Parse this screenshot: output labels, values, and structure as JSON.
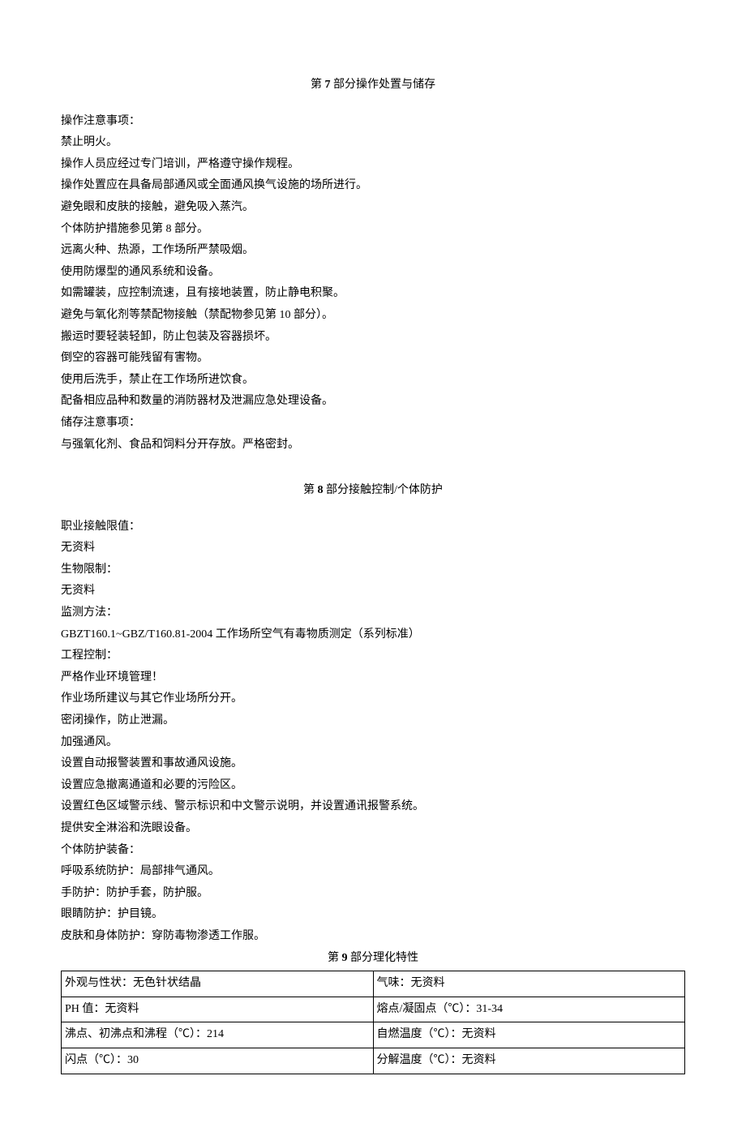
{
  "section7": {
    "heading_pre": "第 ",
    "heading_num": "7",
    "heading_post": " 部分操作处置与储存",
    "lines": [
      "操作注意事项：",
      "禁止明火。",
      "操作人员应经过专门培训，严格遵守操作规程。",
      "操作处置应在具备局部通风或全面通风换气设施的场所进行。",
      "避免眼和皮肤的接触，避免吸入蒸汽。",
      "个体防护措施参见第 8 部分。",
      "远离火种、热源，工作场所严禁吸烟。",
      "使用防爆型的通风系统和设备。",
      "如需罐装，应控制流速，且有接地装置，防止静电积聚。",
      "避免与氧化剂等禁配物接触（禁配物参见第 10 部分）。",
      "搬运时要轻装轻卸，防止包装及容器损坏。",
      "倒空的容器可能残留有害物。",
      "使用后洗手，禁止在工作场所进饮食。",
      "配备相应品种和数量的消防器材及泄漏应急处理设备。",
      "储存注意事项：",
      "与强氧化剂、食品和饲料分开存放。严格密封。"
    ]
  },
  "section8": {
    "heading_pre": "第 ",
    "heading_num": "8",
    "heading_post": " 部分接触控制/个体防护",
    "lines": [
      "职业接触限值：",
      "无资料",
      "生物限制：",
      "无资料",
      "监测方法：",
      "GBZT160.1~GBZ/T160.81-2004 工作场所空气有毒物质测定（系列标准）",
      "工程控制：",
      "严格作业环境管理！",
      "作业场所建议与其它作业场所分开。",
      "密闭操作，防止泄漏。",
      "加强通风。",
      "设置自动报警装置和事故通风设施。",
      "设置应急撤离通道和必要的污险区。",
      "设置红色区域警示线、警示标识和中文警示说明，并设置通讯报警系统。",
      "提供安全淋浴和洗眼设备。",
      "个体防护装备：",
      "呼吸系统防护：局部排气通风。",
      "手防护：防护手套，防护服。",
      "眼睛防护：护目镜。",
      "皮肤和身体防护：穿防毒物渗透工作服。"
    ]
  },
  "section9": {
    "heading_pre": "第 ",
    "heading_num": "9",
    "heading_post": " 部分理化特性",
    "table": [
      {
        "left": "外观与性状：无色针状结晶",
        "right": "气味：无资料"
      },
      {
        "left": "PH 值：无资料",
        "right": "熔点/凝固点（℃）：31-34"
      },
      {
        "left": "沸点、初沸点和沸程（℃）：214",
        "right": "自燃温度（℃）：无资料"
      },
      {
        "left": "闪点（℃）：30",
        "right": "分解温度（℃）：无资料"
      }
    ]
  },
  "chart_data": {
    "type": "table",
    "title": "第9部分理化特性",
    "rows": [
      {
        "外观与性状": "无色针状结晶",
        "气味": "无资料"
      },
      {
        "PH 值": "无资料",
        "熔点/凝固点（℃）": "31-34"
      },
      {
        "沸点、初沸点和沸程（℃）": "214",
        "自燃温度（℃）": "无资料"
      },
      {
        "闪点（℃）": "30",
        "分解温度（℃）": "无资料"
      }
    ]
  }
}
